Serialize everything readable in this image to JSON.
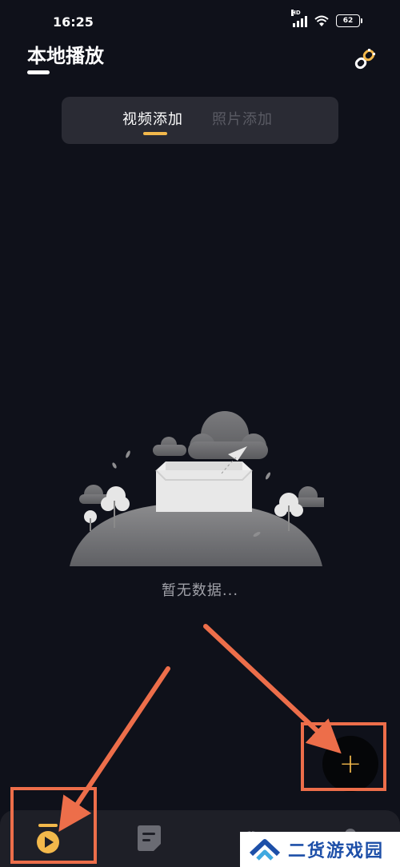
{
  "status_bar": {
    "time": "16:25",
    "network": "HD",
    "battery": "62"
  },
  "header": {
    "title": "本地播放",
    "link_icon": "link-broken-icon"
  },
  "tabs": [
    {
      "label": "视频添加",
      "active": true
    },
    {
      "label": "照片添加",
      "active": false
    }
  ],
  "empty_state": {
    "message": "暂无数据..."
  },
  "fab": {
    "icon": "plus-icon",
    "symbol": "+"
  },
  "bottom_nav": [
    {
      "icon": "play-icon",
      "active": true
    },
    {
      "icon": "note-icon",
      "active": false
    },
    {
      "icon": "star-icon",
      "active": false
    },
    {
      "icon": "profile-icon",
      "active": false
    }
  ],
  "watermark": {
    "text": "二货游戏园"
  },
  "colors": {
    "accent": "#f2b84b",
    "background": "#0f111a",
    "highlight": "#ed6e4a"
  }
}
